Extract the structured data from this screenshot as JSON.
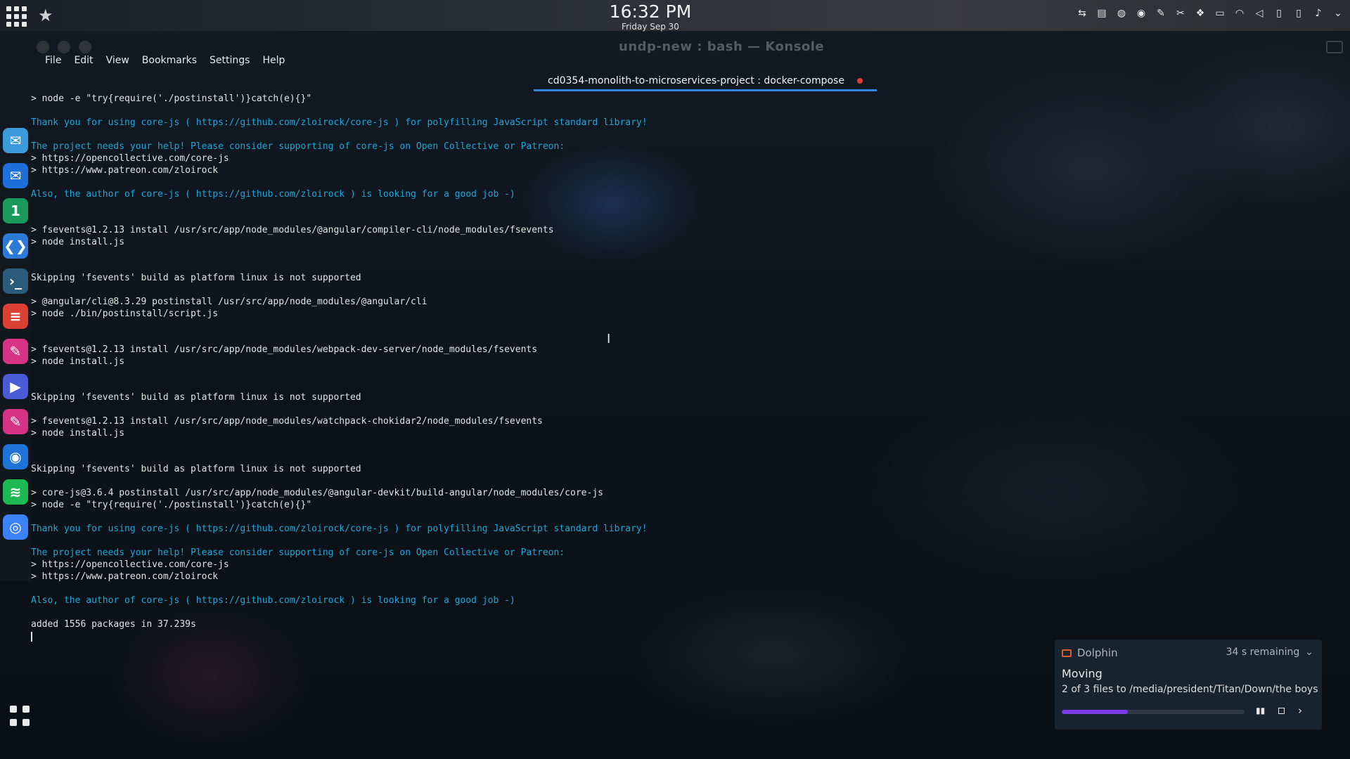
{
  "top_panel": {
    "time": "16:32 PM",
    "date": "Friday Sep 30",
    "tray_icons": [
      "network-icon",
      "drive-icon",
      "media-icon",
      "chrome-icon",
      "notes-icon",
      "scissors-icon",
      "dropbox-icon",
      "display-icon",
      "wifi-icon",
      "volume-icon",
      "battery-icon",
      "phone-icon",
      "microphone-icon",
      "chevron-down-icon"
    ]
  },
  "dock": {
    "apps": [
      {
        "name": "mail-notify-icon",
        "color": "#3b9ad9",
        "glyph": "✉"
      },
      {
        "name": "mail-icon",
        "color": "#1e6fd9",
        "glyph": "✉"
      },
      {
        "name": "tasks-icon",
        "color": "#1a9a5a",
        "glyph": "1"
      },
      {
        "name": "vscode-icon",
        "color": "#2b7bd6",
        "glyph": "❮❯"
      },
      {
        "name": "terminal-icon",
        "color": "#2a5b7a",
        "glyph": "›_"
      },
      {
        "name": "todoist-icon",
        "color": "#db4035",
        "glyph": "≡"
      },
      {
        "name": "editor-icon",
        "color": "#d63384",
        "glyph": "✎"
      },
      {
        "name": "media-player-icon",
        "color": "#4a5bd6",
        "glyph": "▶"
      },
      {
        "name": "editor2-icon",
        "color": "#d63384",
        "glyph": "✎"
      },
      {
        "name": "firefox-icon",
        "color": "#1e74d6",
        "glyph": "◉"
      },
      {
        "name": "spotify-icon",
        "color": "#1db954",
        "glyph": "≋"
      },
      {
        "name": "chromium-icon",
        "color": "#3b82f6",
        "glyph": "◎"
      }
    ]
  },
  "window": {
    "title": "undp-new : bash — Konsole",
    "menu": [
      "File",
      "Edit",
      "View",
      "Bookmarks",
      "Settings",
      "Help"
    ],
    "tab_label": "cd0354-monolith-to-microservices-project : docker-compose"
  },
  "terminal": {
    "lines": [
      {
        "t": "> node -e \"try{require('./postinstall')}catch(e){}\"",
        "c": "white"
      },
      {
        "t": "",
        "c": "white"
      },
      {
        "t": "Thank you for using core-js ( https://github.com/zloirock/core-js ) for polyfilling JavaScript standard library!",
        "c": "cyan"
      },
      {
        "t": "",
        "c": "white"
      },
      {
        "t": "The project needs your help! Please consider supporting of core-js on Open Collective or Patreon:",
        "c": "cyan"
      },
      {
        "t": "> https://opencollective.com/core-js",
        "c": "white"
      },
      {
        "t": "> https://www.patreon.com/zloirock",
        "c": "white"
      },
      {
        "t": "",
        "c": "white"
      },
      {
        "t": "Also, the author of core-js ( https://github.com/zloirock ) is looking for a good job -)",
        "c": "cyan"
      },
      {
        "t": "",
        "c": "white"
      },
      {
        "t": "",
        "c": "white"
      },
      {
        "t": "> fsevents@1.2.13 install /usr/src/app/node_modules/@angular/compiler-cli/node_modules/fsevents",
        "c": "white"
      },
      {
        "t": "> node install.js",
        "c": "white"
      },
      {
        "t": "",
        "c": "white"
      },
      {
        "t": "",
        "c": "white"
      },
      {
        "t": "Skipping 'fsevents' build as platform linux is not supported",
        "c": "white"
      },
      {
        "t": "",
        "c": "white"
      },
      {
        "t": "> @angular/cli@8.3.29 postinstall /usr/src/app/node_modules/@angular/cli",
        "c": "white"
      },
      {
        "t": "> node ./bin/postinstall/script.js",
        "c": "white"
      },
      {
        "t": "",
        "c": "white"
      },
      {
        "t": "",
        "c": "white"
      },
      {
        "t": "> fsevents@1.2.13 install /usr/src/app/node_modules/webpack-dev-server/node_modules/fsevents",
        "c": "white"
      },
      {
        "t": "> node install.js",
        "c": "white"
      },
      {
        "t": "",
        "c": "white"
      },
      {
        "t": "",
        "c": "white"
      },
      {
        "t": "Skipping 'fsevents' build as platform linux is not supported",
        "c": "white"
      },
      {
        "t": "",
        "c": "white"
      },
      {
        "t": "> fsevents@1.2.13 install /usr/src/app/node_modules/watchpack-chokidar2/node_modules/fsevents",
        "c": "white"
      },
      {
        "t": "> node install.js",
        "c": "white"
      },
      {
        "t": "",
        "c": "white"
      },
      {
        "t": "",
        "c": "white"
      },
      {
        "t": "Skipping 'fsevents' build as platform linux is not supported",
        "c": "white"
      },
      {
        "t": "",
        "c": "white"
      },
      {
        "t": "> core-js@3.6.4 postinstall /usr/src/app/node_modules/@angular-devkit/build-angular/node_modules/core-js",
        "c": "white"
      },
      {
        "t": "> node -e \"try{require('./postinstall')}catch(e){}\"",
        "c": "white"
      },
      {
        "t": "",
        "c": "white"
      },
      {
        "t": "Thank you for using core-js ( https://github.com/zloirock/core-js ) for polyfilling JavaScript standard library!",
        "c": "cyan"
      },
      {
        "t": "",
        "c": "white"
      },
      {
        "t": "The project needs your help! Please consider supporting of core-js on Open Collective or Patreon:",
        "c": "cyan"
      },
      {
        "t": "> https://opencollective.com/core-js",
        "c": "white"
      },
      {
        "t": "> https://www.patreon.com/zloirock",
        "c": "white"
      },
      {
        "t": "",
        "c": "white"
      },
      {
        "t": "Also, the author of core-js ( https://github.com/zloirock ) is looking for a good job -)",
        "c": "cyan"
      },
      {
        "t": "",
        "c": "white"
      },
      {
        "t": "added 1556 packages in 37.239s",
        "c": "white"
      }
    ]
  },
  "notification": {
    "app": "Dolphin",
    "remaining": "34 s remaining",
    "title": "Moving",
    "body": "2 of 3 files to /media/president/Titan/Down/the boys",
    "progress_fraction": 0.36,
    "accent_color": "#7c3aed"
  }
}
